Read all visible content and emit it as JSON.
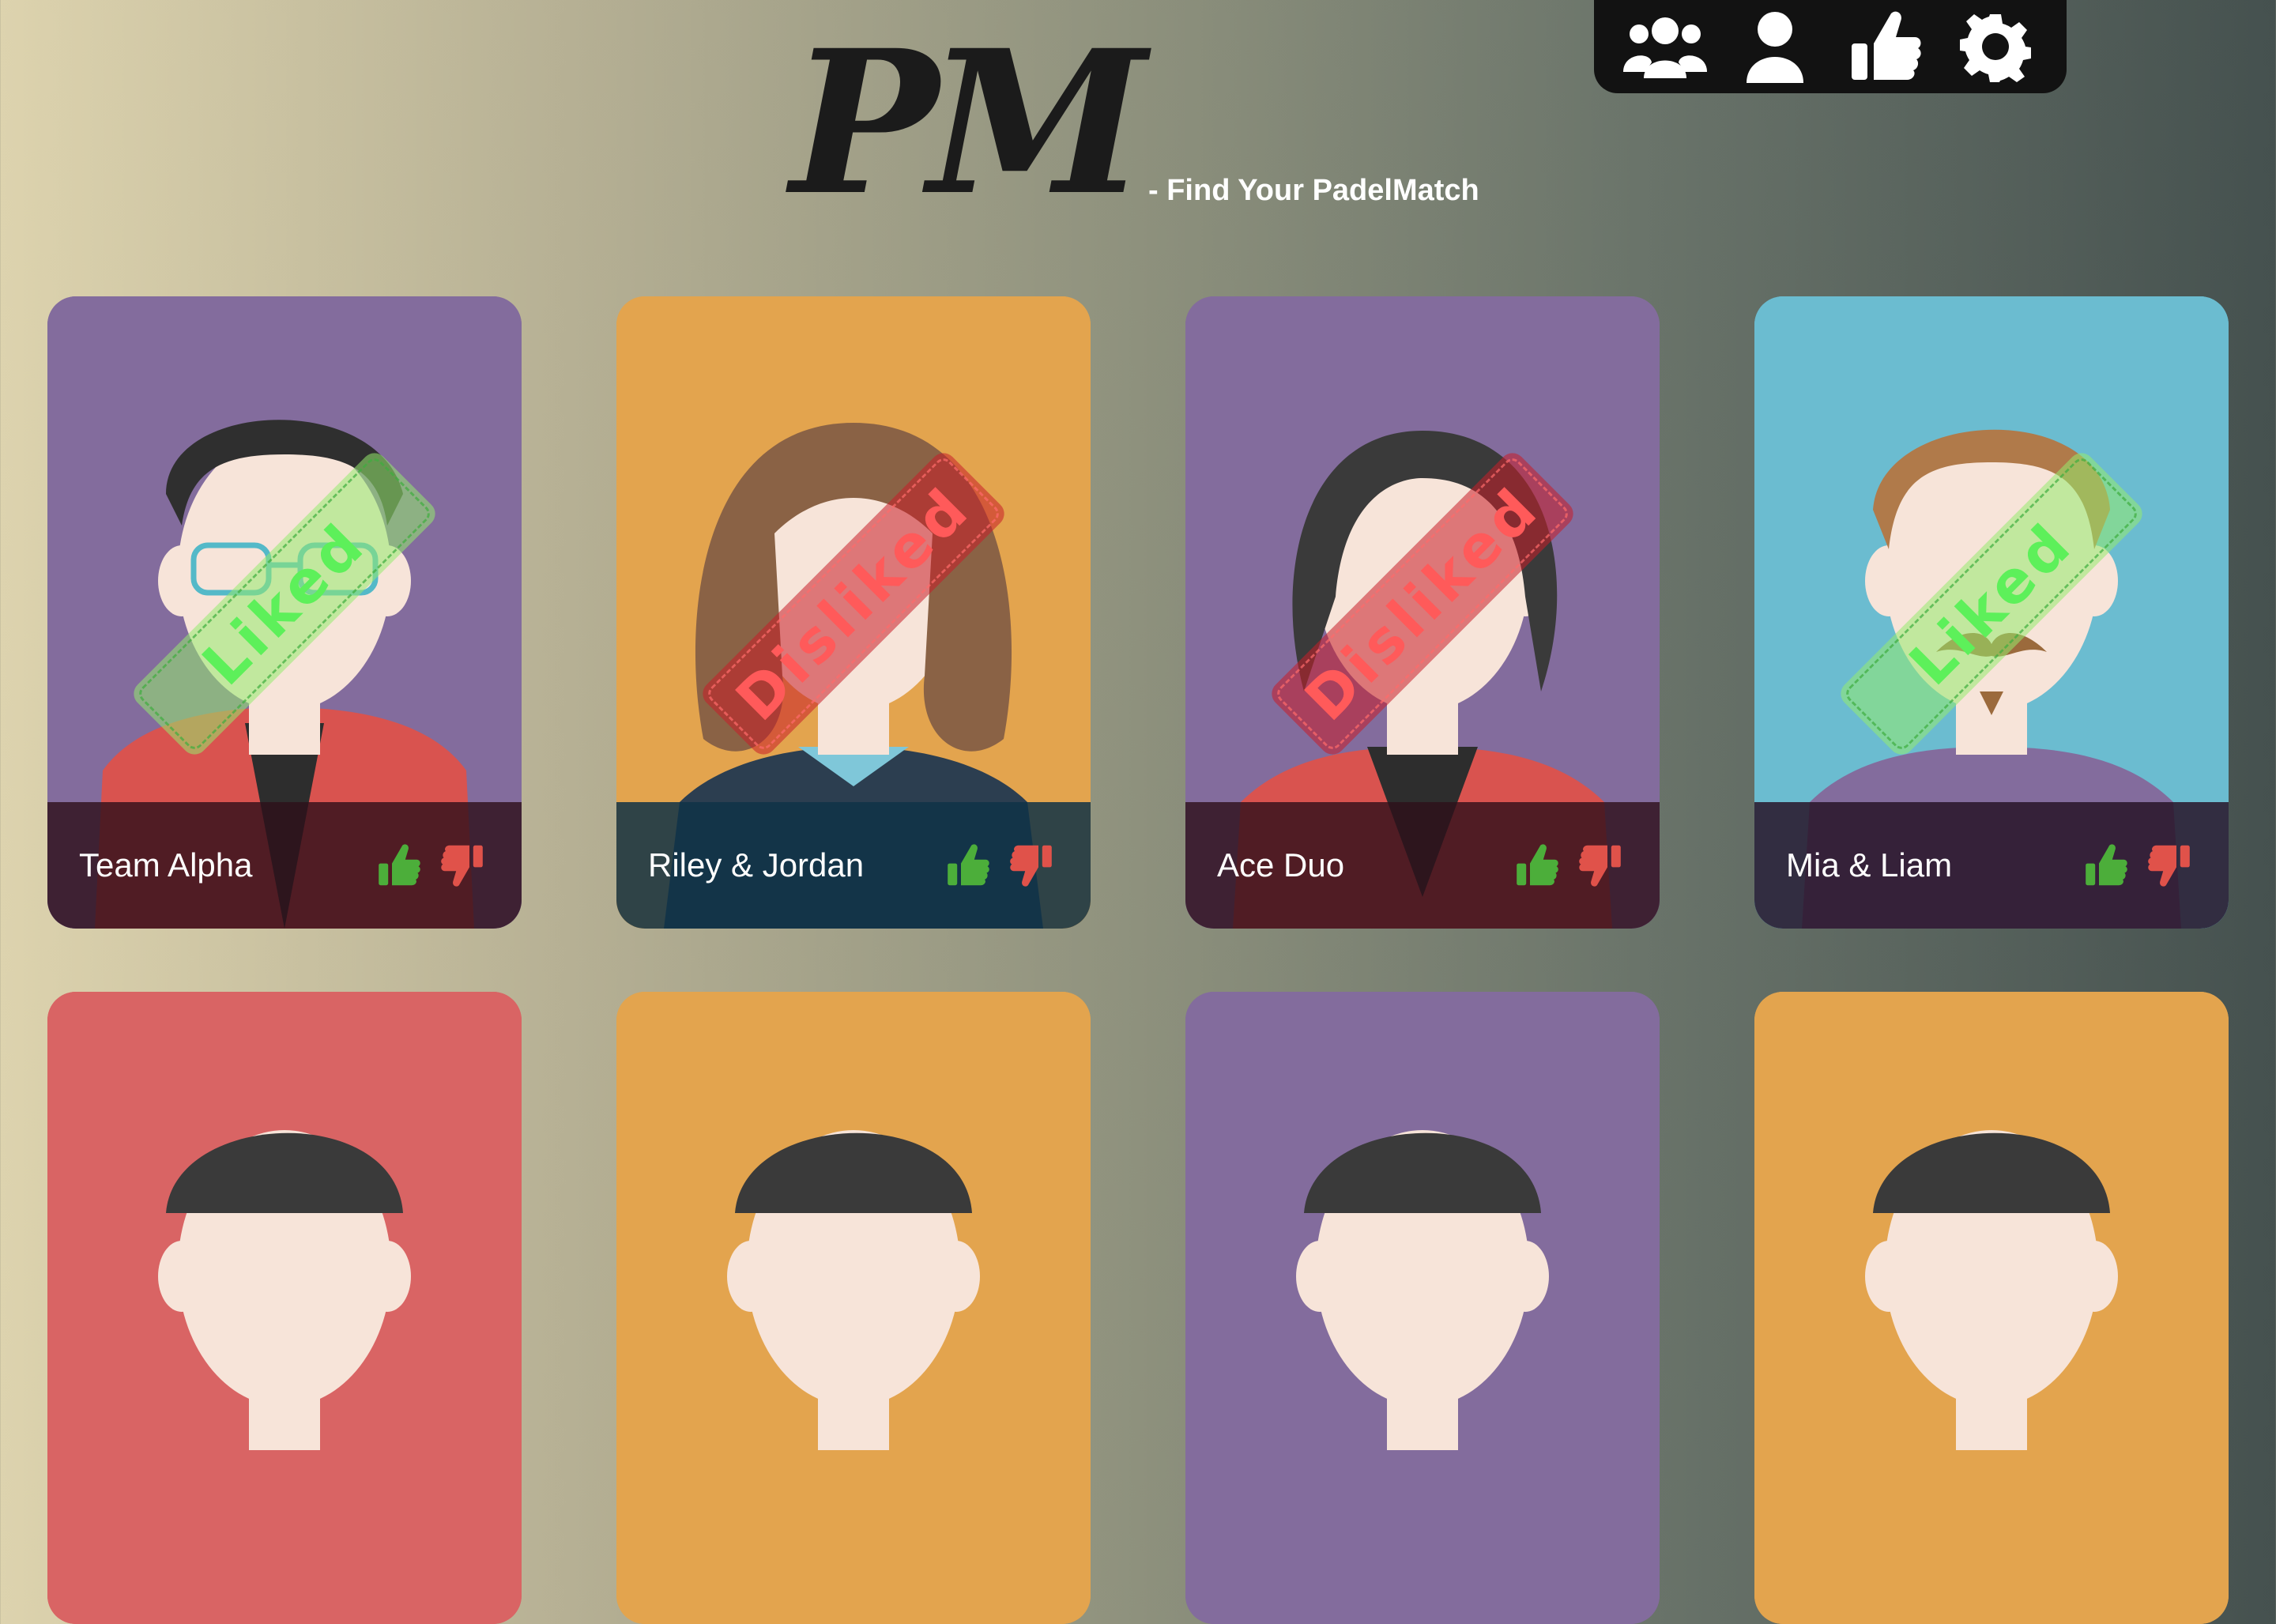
{
  "app": {
    "logo_text": "PM",
    "tagline": "- Find Your PadelMatch"
  },
  "nav": {
    "items": [
      {
        "icon": "group-icon"
      },
      {
        "icon": "user-icon"
      },
      {
        "icon": "thumbs-up-icon"
      },
      {
        "icon": "gear-icon"
      }
    ]
  },
  "colors": {
    "liked": "#5df05a",
    "disliked": "#ff5a5a",
    "thumb_up": "#4cae3a",
    "thumb_down": "#e0524a"
  },
  "cards": [
    {
      "name": "Team Alpha",
      "status": "Liked",
      "bg": "#836c9d",
      "avatar": "man-glasses"
    },
    {
      "name": "Riley & Jordan",
      "status": "Disliked",
      "bg": "#e3a44e",
      "avatar": "woman-brown"
    },
    {
      "name": "Ace Duo",
      "status": "Disliked",
      "bg": "#836c9d",
      "avatar": "woman-dark"
    },
    {
      "name": "Mia & Liam",
      "status": "Liked",
      "bg": "#6bbcd0",
      "avatar": "man-mustache"
    },
    {
      "name": "",
      "status": "",
      "bg": "#d96464",
      "avatar": ""
    },
    {
      "name": "",
      "status": "",
      "bg": "#e3a44e",
      "avatar": ""
    },
    {
      "name": "",
      "status": "",
      "bg": "#836c9d",
      "avatar": ""
    },
    {
      "name": "",
      "status": "",
      "bg": "#e3a44e",
      "avatar": ""
    }
  ]
}
